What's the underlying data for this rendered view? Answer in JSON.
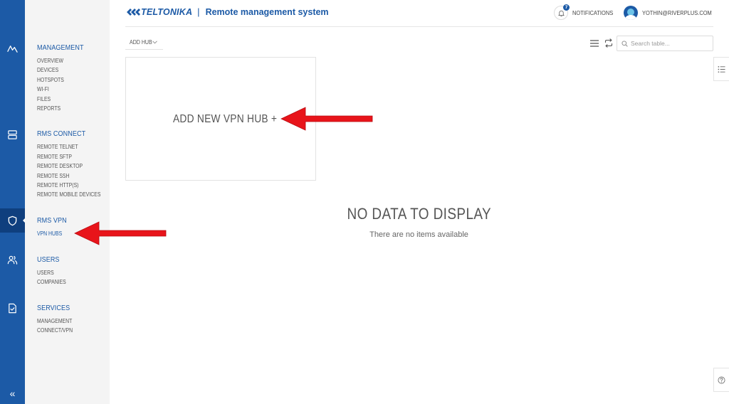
{
  "header": {
    "brand": "TELTONIKA",
    "separator": "|",
    "system_title": "Remote management system",
    "notifications_label": "NOTIFICATIONS",
    "notifications_count": "7",
    "user_email": "YOTHIN@RIVERPLUS.COM"
  },
  "rail": {
    "items": [
      {
        "name": "management",
        "icon": "activity-icon"
      },
      {
        "name": "rms-connect",
        "icon": "server-icon"
      },
      {
        "name": "rms-vpn",
        "icon": "shield-icon",
        "active": true
      },
      {
        "name": "users",
        "icon": "users-icon"
      },
      {
        "name": "services",
        "icon": "file-check-icon"
      }
    ],
    "collapse_label": "«"
  },
  "nav": {
    "sections": [
      {
        "title": "MANAGEMENT",
        "items": [
          "OVERVIEW",
          "DEVICES",
          "HOTSPOTS",
          "WI-FI",
          "FILES",
          "REPORTS"
        ]
      },
      {
        "title": "RMS CONNECT",
        "items": [
          "REMOTE TELNET",
          "REMOTE SFTP",
          "REMOTE DESKTOP",
          "REMOTE SSH",
          "REMOTE HTTP(S)",
          "REMOTE MOBILE DEVICES"
        ]
      },
      {
        "title": "RMS VPN",
        "items": [
          "VPN HUBS"
        ]
      },
      {
        "title": "USERS",
        "items": [
          "USERS",
          "COMPANIES"
        ]
      },
      {
        "title": "SERVICES",
        "items": [
          "MANAGEMENT",
          "CONNECT/VPN"
        ]
      }
    ],
    "active_item": "VPN HUBS"
  },
  "toolbar": {
    "add_hub_label": "ADD HUB",
    "search_placeholder": "Search table..."
  },
  "card": {
    "label": "ADD NEW VPN HUB +"
  },
  "empty_state": {
    "title": "NO DATA TO DISPLAY",
    "subtitle": "There are no items available"
  },
  "colors": {
    "brand_blue": "#1c5aa6",
    "rail_active": "#0f3f7e",
    "arrow_red": "#e8141a"
  }
}
